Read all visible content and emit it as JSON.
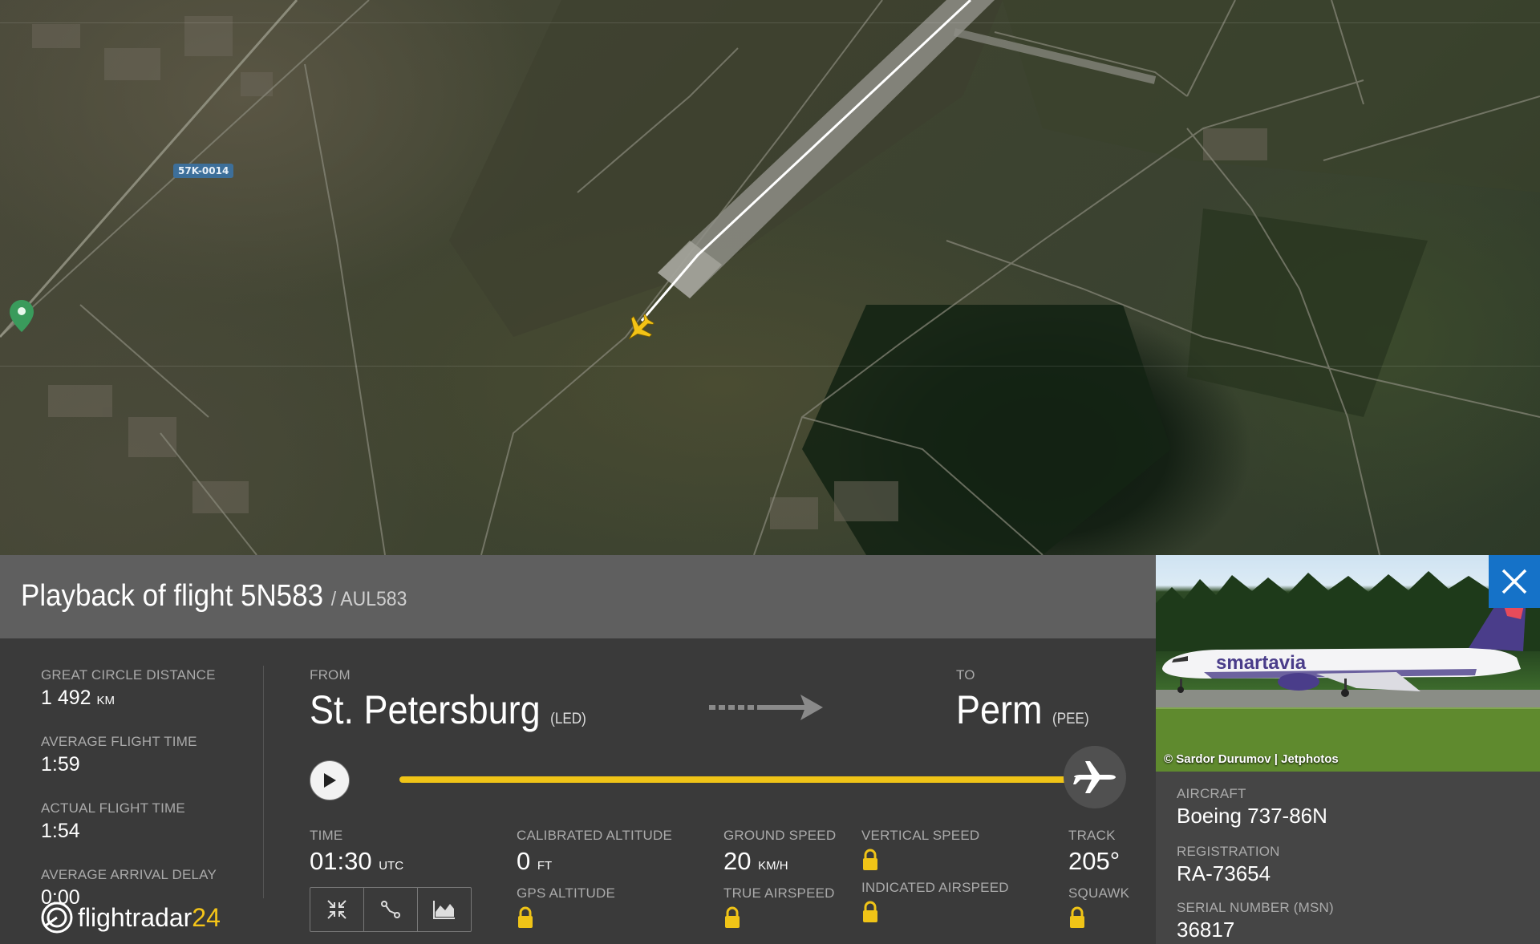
{
  "map": {
    "road_label": "57K-0014"
  },
  "header": {
    "title": "Playback of flight 5N583",
    "callsign": "/ AUL583"
  },
  "stats": {
    "distance_label": "GREAT CIRCLE DISTANCE",
    "distance_value": "1 492",
    "distance_unit": "KM",
    "avg_time_label": "AVERAGE FLIGHT TIME",
    "avg_time_value": "1:59",
    "actual_time_label": "ACTUAL FLIGHT TIME",
    "actual_time_value": "1:54",
    "delay_label": "AVERAGE ARRIVAL DELAY",
    "delay_value": "0:00"
  },
  "logo": {
    "text": "flightradar",
    "num": "24"
  },
  "route": {
    "from_label": "FROM",
    "from_city": "St. Petersburg",
    "from_code": "(LED)",
    "to_label": "TO",
    "to_city": "Perm",
    "to_code": "(PEE)"
  },
  "playback": {
    "progress": 1.0
  },
  "metrics": {
    "time_label": "TIME",
    "time_value": "01:30",
    "time_unit": "UTC",
    "cal_alt_label": "CALIBRATED ALTITUDE",
    "cal_alt_value": "0",
    "cal_alt_unit": "FT",
    "gps_alt_label": "GPS ALTITUDE",
    "ground_speed_label": "GROUND SPEED",
    "ground_speed_value": "20",
    "ground_speed_unit": "KM/H",
    "true_airspeed_label": "TRUE AIRSPEED",
    "vertical_speed_label": "VERTICAL SPEED",
    "indicated_airspeed_label": "INDICATED AIRSPEED",
    "track_label": "TRACK",
    "track_value": "205°",
    "squawk_label": "SQUAWK"
  },
  "aircraft": {
    "photo_credit": "© Sardor Durumov | Jetphotos",
    "photo_livery": "smartavia",
    "aircraft_label": "AIRCRAFT",
    "aircraft_value": "Boeing 737-86N",
    "registration_label": "REGISTRATION",
    "registration_value": "RA-73654",
    "serial_label": "SERIAL NUMBER (MSN)",
    "serial_value": "36817"
  },
  "colors": {
    "accent_yellow": "#f0c417",
    "close_blue": "#1572c8"
  }
}
